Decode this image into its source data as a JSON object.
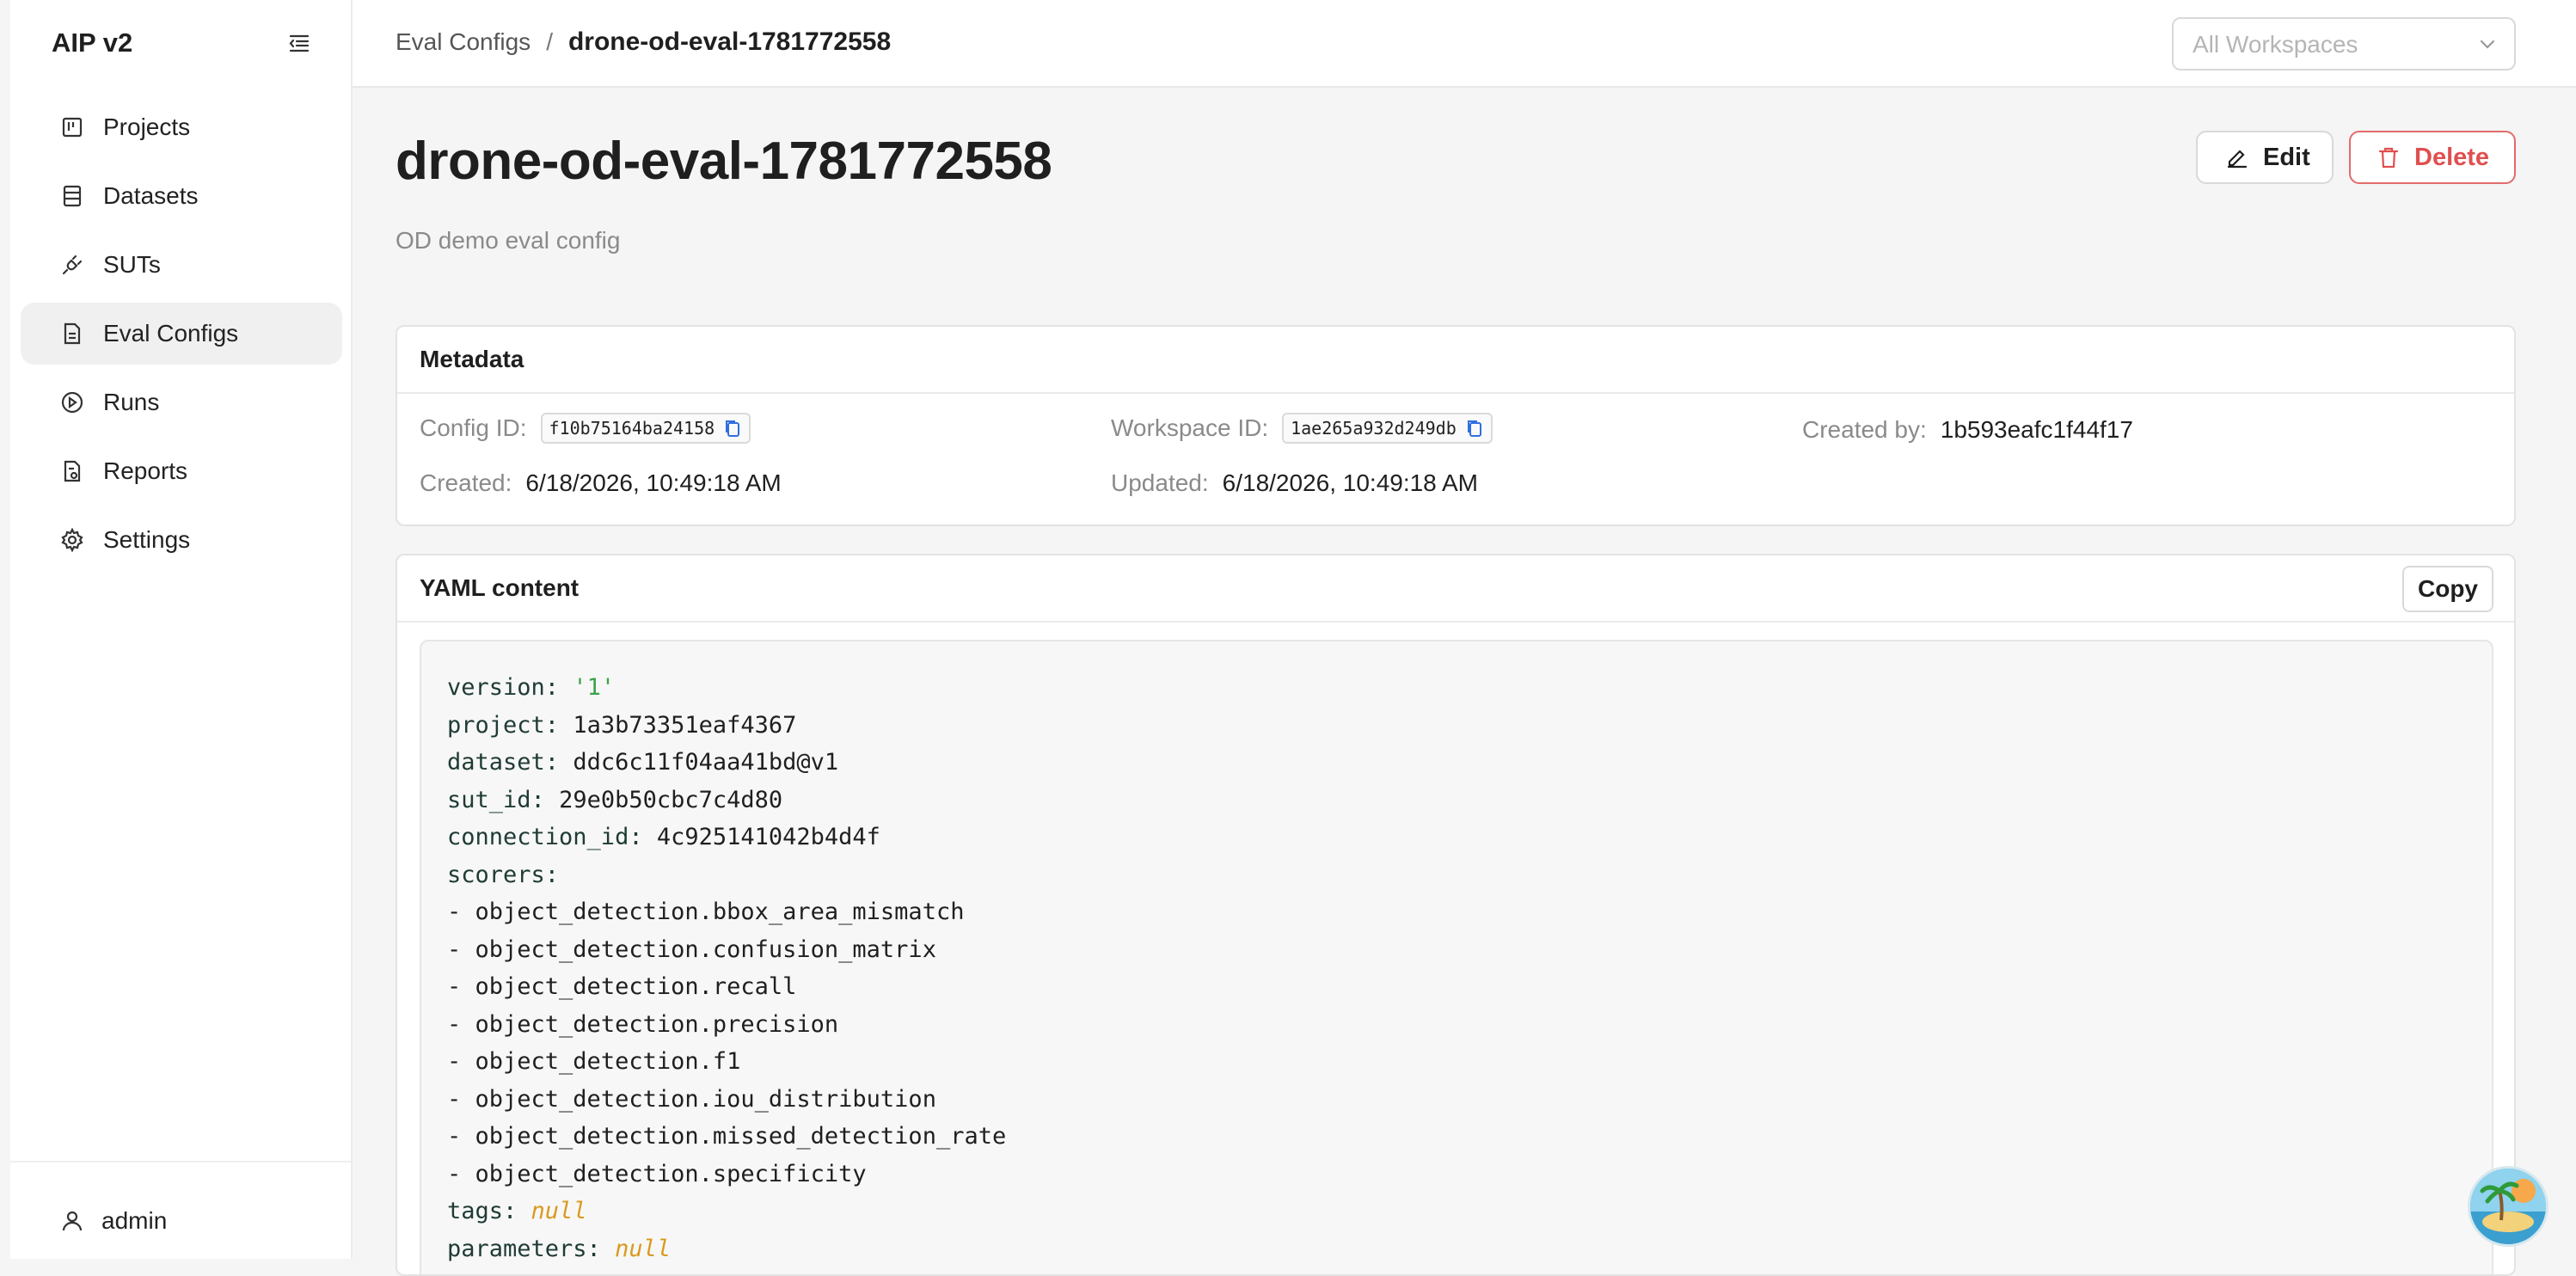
{
  "app": {
    "title": "AIP v2"
  },
  "sidebar": {
    "items": [
      {
        "label": "Projects",
        "icon": "projects-icon"
      },
      {
        "label": "Datasets",
        "icon": "datasets-icon"
      },
      {
        "label": "SUTs",
        "icon": "suts-icon"
      },
      {
        "label": "Eval Configs",
        "icon": "eval-configs-icon",
        "active": true
      },
      {
        "label": "Runs",
        "icon": "runs-icon"
      },
      {
        "label": "Reports",
        "icon": "reports-icon"
      },
      {
        "label": "Settings",
        "icon": "settings-icon"
      }
    ],
    "user": "admin"
  },
  "header": {
    "breadcrumb_parent": "Eval Configs",
    "breadcrumb_sep": "/",
    "breadcrumb_current": "drone-od-eval-1781772558",
    "workspace_placeholder": "All Workspaces"
  },
  "page": {
    "title": "drone-od-eval-1781772558",
    "description": "OD demo eval config",
    "edit_label": "Edit",
    "delete_label": "Delete"
  },
  "metadata": {
    "title": "Metadata",
    "config_id_label": "Config ID:",
    "config_id": "f10b75164ba24158",
    "workspace_id_label": "Workspace ID:",
    "workspace_id": "1ae265a932d249db",
    "created_by_label": "Created by:",
    "created_by": "1b593eafc1f44f17",
    "created_label": "Created:",
    "created": "6/18/2026, 10:49:18 AM",
    "updated_label": "Updated:",
    "updated": "6/18/2026, 10:49:18 AM"
  },
  "yaml": {
    "title": "YAML content",
    "copy_label": "Copy",
    "version_key": "version:",
    "version_val": "'1'",
    "project_key": "project:",
    "project_val": "1a3b73351eaf4367",
    "dataset_key": "dataset:",
    "dataset_val": "ddc6c11f04aa41bd@v1",
    "sut_key": "sut_id:",
    "sut_val": "29e0b50cbc7c4d80",
    "connection_key": "connection_id:",
    "connection_val": "4c925141042b4d4f",
    "scorers_key": "scorers:",
    "scorers": [
      "object_detection.bbox_area_mismatch",
      "object_detection.confusion_matrix",
      "object_detection.recall",
      "object_detection.precision",
      "object_detection.f1",
      "object_detection.iou_distribution",
      "object_detection.missed_detection_rate",
      "object_detection.specificity"
    ],
    "tags_key": "tags:",
    "tags_val": "null",
    "parameters_key": "parameters:",
    "parameters_val": "null"
  },
  "colors": {
    "danger": "#e04f4f",
    "yaml_string": "#3aa34a",
    "yaml_null": "#d99a1e"
  }
}
